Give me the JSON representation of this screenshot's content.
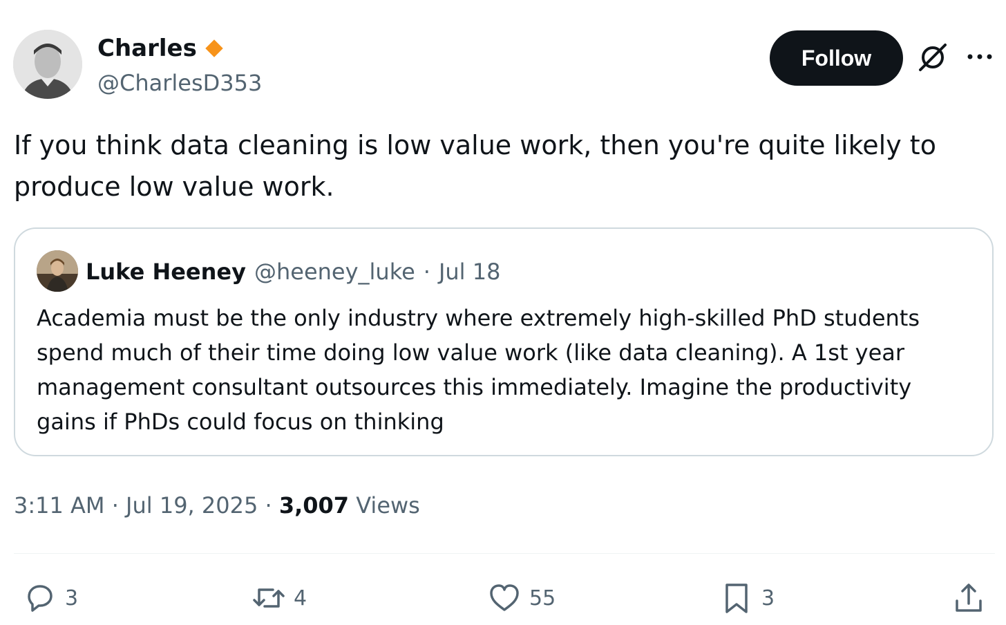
{
  "tweet": {
    "author": {
      "name": "Charles",
      "handle": "@CharlesD353",
      "avatar_icon": "avatar-photo",
      "badge_icon": "verified-diamond-icon",
      "badge_color": "#f7931a"
    },
    "follow_label": "Follow",
    "text": "If you think data cleaning is low value work, then you're quite likely to produce low value work.",
    "quoted": {
      "name": "Luke Heeney",
      "handle": "@heeney_luke",
      "separator": "·",
      "date": "Jul 18",
      "text": "Academia must be the only industry where extremely high-skilled PhD students spend much of their time doing low value work (like data cleaning). A 1st year management consultant outsources this immediately. Imagine the productivity gains if PhDs could focus on thinking"
    },
    "timestamp": "3:11 AM · Jul 19, 2025 ·",
    "views_count": "3,007",
    "views_label": "Views",
    "actions": {
      "replies": "3",
      "reposts": "4",
      "likes": "55",
      "bookmarks": "3"
    }
  },
  "colors": {
    "text_primary": "#0f1419",
    "text_secondary": "#536471",
    "border": "#cfd9de",
    "follow_bg": "#0f1419"
  }
}
